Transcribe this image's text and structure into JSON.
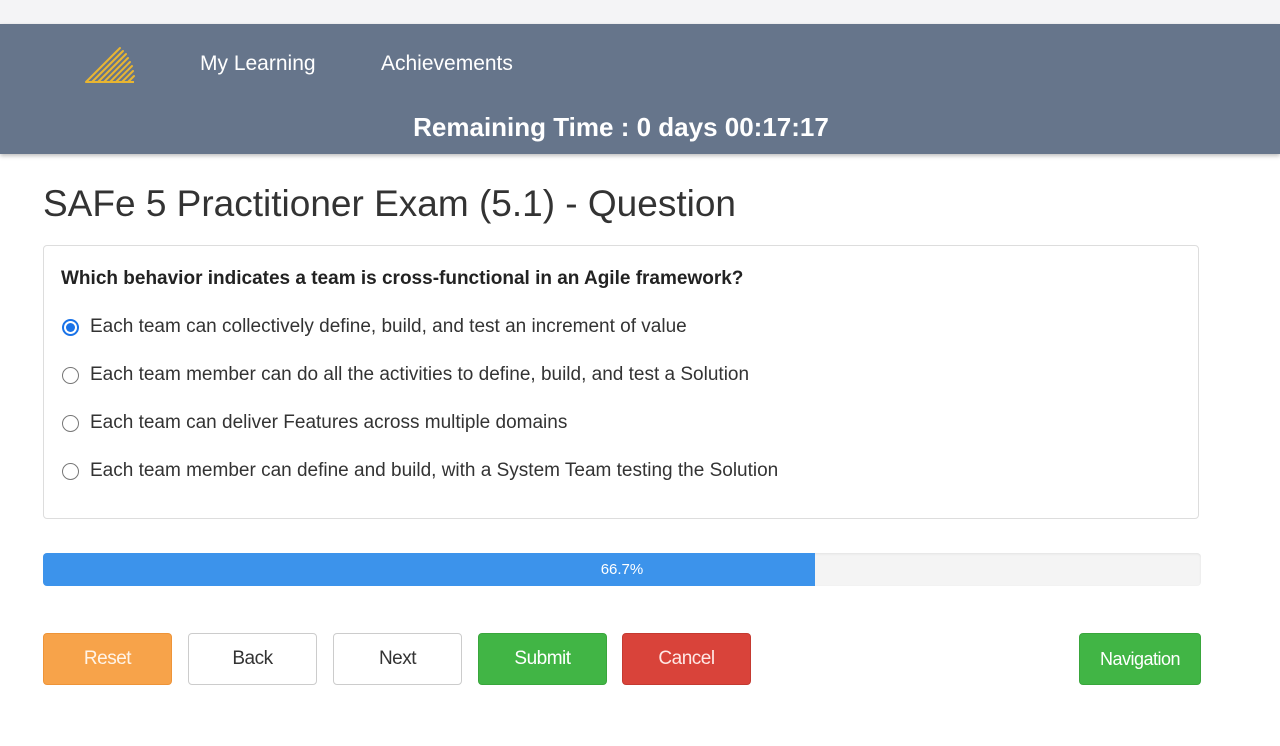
{
  "header": {
    "logo_icon": "diagonal-stripes-logo-icon",
    "nav": [
      {
        "label": "My Learning"
      },
      {
        "label": "Achievements"
      }
    ],
    "remaining_time": "Remaining Time : 0 days 00:17:17"
  },
  "page": {
    "title": "SAFe 5 Practitioner Exam (5.1) - Question"
  },
  "question": {
    "text": "Which behavior indicates a team is cross-functional in an Agile framework?",
    "selected_index": 0,
    "options": [
      {
        "label": "Each team can collectively define, build, and test an increment of value",
        "selected": true
      },
      {
        "label": "Each team member can do all the activities to define, build, and test a Solution",
        "selected": false
      },
      {
        "label": "Each team can deliver Features across multiple domains",
        "selected": false
      },
      {
        "label": "Each team member can define and build, with a System Team testing the Solution",
        "selected": false
      }
    ]
  },
  "progress": {
    "value_percent": 66.7,
    "label": "66.7%"
  },
  "buttons": {
    "reset": "Reset",
    "back": "Back",
    "next": "Next",
    "submit": "Submit",
    "cancel": "Cancel",
    "navigation": "Navigation"
  },
  "colors": {
    "navbar": "#66758b",
    "progress_fill": "#3c93eb",
    "reset": "#f7a34a",
    "submit": "#41b545",
    "cancel": "#d9433a",
    "navigation": "#41b545",
    "radio_selected": "#1a73e8"
  }
}
